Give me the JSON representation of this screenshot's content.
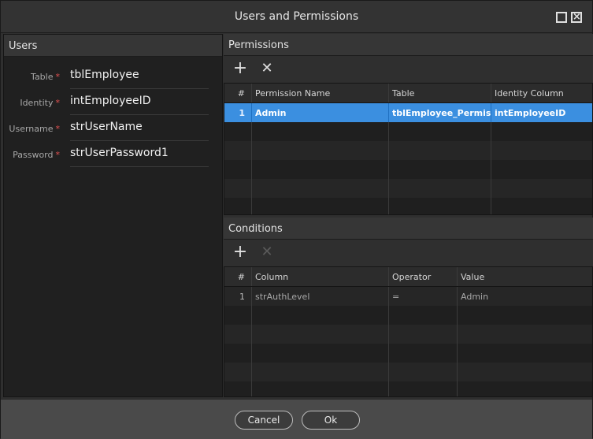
{
  "window": {
    "title": "Users and Permissions"
  },
  "users": {
    "header": "Users",
    "fields": [
      {
        "label": "Table",
        "required": "*",
        "value": "tblEmployee"
      },
      {
        "label": "Identity",
        "required": "*",
        "value": "intEmployeeID"
      },
      {
        "label": "Username",
        "required": "*",
        "value": "strUserName"
      },
      {
        "label": "Password",
        "required": "*",
        "value": "strUserPassword1"
      }
    ]
  },
  "permissions": {
    "header": "Permissions",
    "add_icon": "plus-icon",
    "remove_icon": "x-icon",
    "columns": [
      "#",
      "Permission Name",
      "Table",
      "Identity Column"
    ],
    "rows": [
      {
        "num": "1",
        "name": "Admin",
        "table": "tblEmployee_Permis...",
        "identity": "intEmployeeID"
      }
    ]
  },
  "conditions": {
    "header": "Conditions",
    "add_icon": "plus-icon",
    "remove_icon": "x-icon",
    "columns": [
      "#",
      "Column",
      "Operator",
      "Value"
    ],
    "rows": [
      {
        "num": "1",
        "column": "strAuthLevel",
        "operator": "=",
        "value": "Admin"
      }
    ]
  },
  "footer": {
    "cancel_label": "Cancel",
    "ok_label": "Ok"
  },
  "colors": {
    "selection": "#3b8fe0",
    "required": "#e05050",
    "background": "#2f2f2f"
  }
}
